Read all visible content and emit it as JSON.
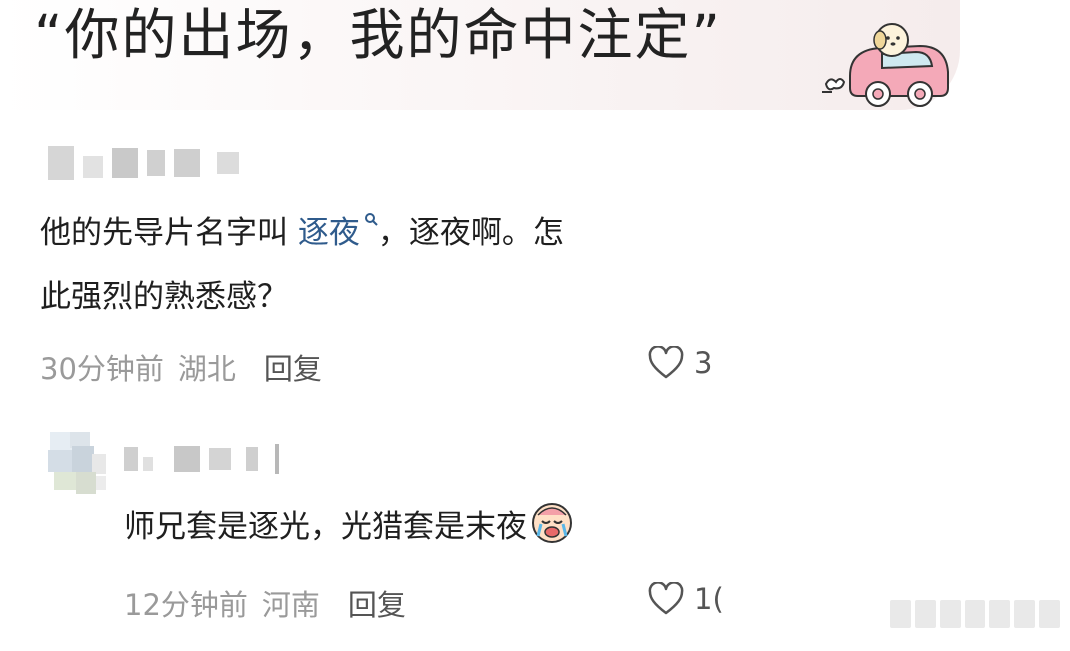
{
  "header": {
    "headline": "“你的出场，我的命中注定”"
  },
  "comments": [
    {
      "text_before_link": "他的先导片名字叫 ",
      "topic_link": "逐夜",
      "text_after_link": "，逐夜啊。怎",
      "text_line2": "此强烈的熟悉感？",
      "time": "30分钟前",
      "location": "湖北",
      "reply_label": "回复",
      "likes": "3"
    },
    {
      "text": "师兄套是逐光，光猎套是末夜",
      "time": "12分钟前",
      "location": "河南",
      "reply_label": "回复",
      "likes": "1("
    }
  ],
  "colors": {
    "link": "#2f5b8c",
    "meta": "#9a9a9a",
    "sticker_pink": "#f4a9b8"
  },
  "icons": [
    "car-sticker-icon",
    "search-icon",
    "heart-icon",
    "crying-emoji-icon",
    "avatar"
  ]
}
